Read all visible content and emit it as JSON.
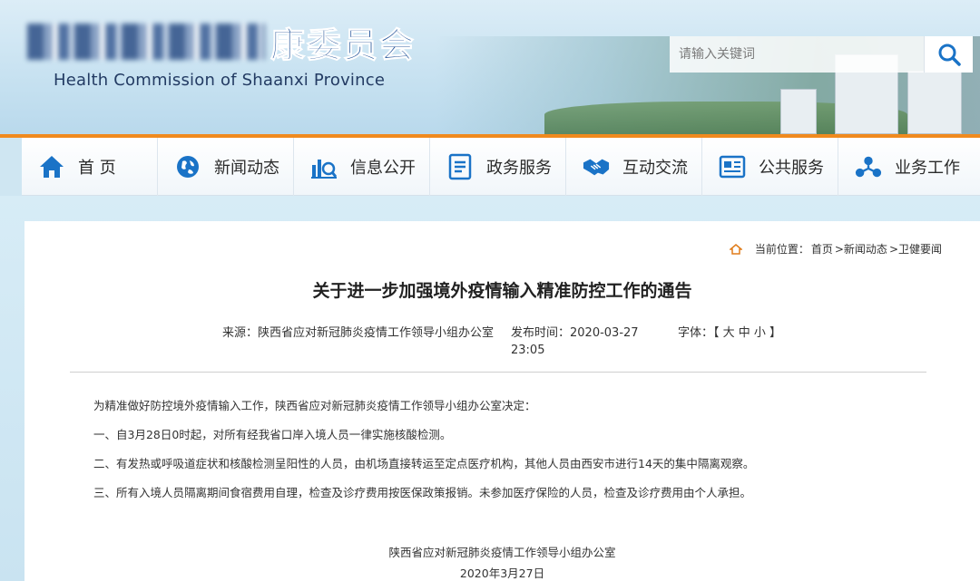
{
  "header": {
    "logo_cn": "康委员会",
    "logo_en": "Health Commission of Shaanxi Province",
    "search_placeholder": "请输入关键词"
  },
  "nav": [
    {
      "label": "首 页",
      "icon": "home-icon"
    },
    {
      "label": "新闻动态",
      "icon": "globe-icon"
    },
    {
      "label": "信息公开",
      "icon": "chart-search-icon"
    },
    {
      "label": "政务服务",
      "icon": "document-icon"
    },
    {
      "label": "互动交流",
      "icon": "handshake-icon"
    },
    {
      "label": "公共服务",
      "icon": "newspaper-icon"
    },
    {
      "label": "业务工作",
      "icon": "network-icon"
    }
  ],
  "breadcrumb": {
    "prefix": "当前位置：",
    "items": [
      "首页",
      ">新闻动态",
      ">卫健要闻"
    ]
  },
  "article": {
    "title": "关于进一步加强境外疫情输入精准防控工作的通告",
    "source_label": "来源：",
    "source_value": "陕西省应对新冠肺炎疫情工作领导小组办公室",
    "time_label": "发布时间：",
    "time_value": "2020-03-27 23:05",
    "font_label": "字体：",
    "font_value": "【 大 中 小 】",
    "paragraphs": [
      "为精准做好防控境外疫情输入工作，陕西省应对新冠肺炎疫情工作领导小组办公室决定：",
      "一、自3月28日0时起，对所有经我省口岸入境人员一律实施核酸检测。",
      "二、有发热或呼吸道症状和核酸检测呈阳性的人员，由机场直接转运至定点医疗机构，其他人员由西安市进行14天的集中隔离观察。",
      "三、所有入境人员隔离期间食宿费用自理，检查及诊疗费用按医保政策报销。未参加医疗保险的人员，检查及诊疗费用由个人承担。"
    ],
    "signature": "陕西省应对新冠肺炎疫情工作领导小组办公室",
    "date": "2020年3月27日"
  },
  "colors": {
    "accent": "#f08a1e",
    "brand_blue": "#1e4f96",
    "icon_blue": "#1a73c7"
  }
}
